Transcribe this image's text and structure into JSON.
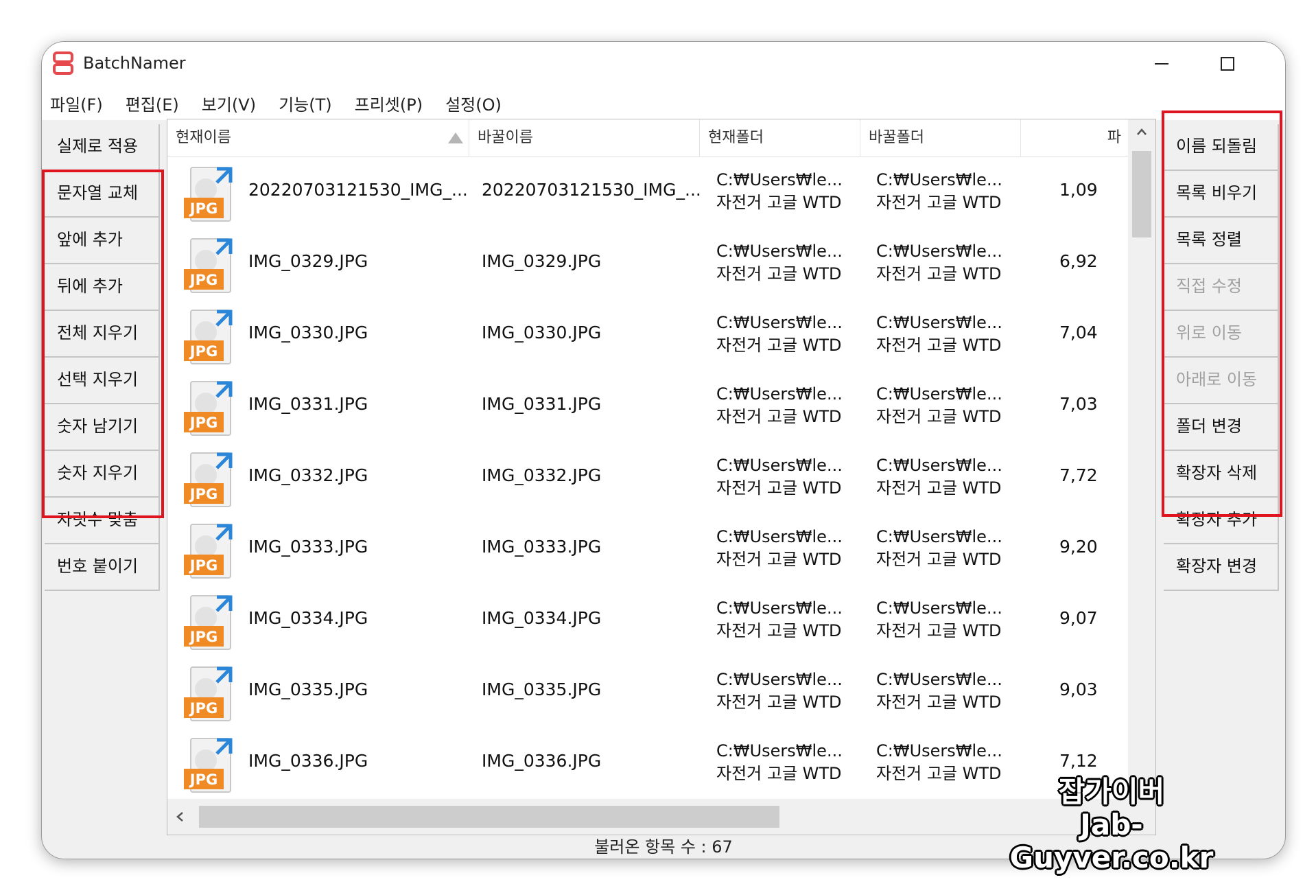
{
  "window": {
    "title": "BatchNamer"
  },
  "menu": [
    "파일(F)",
    "편집(E)",
    "보기(V)",
    "기능(T)",
    "프리셋(P)",
    "설정(O)"
  ],
  "left_buttons": [
    "실제로 적용",
    "문자열 교체",
    "앞에 추가",
    "뒤에 추가",
    "전체 지우기",
    "선택 지우기",
    "숫자 남기기",
    "숫자 지우기",
    "자릿수 맞춤",
    "번호 붙이기"
  ],
  "right_buttons": [
    {
      "label": "이름 되돌림",
      "enabled": true
    },
    {
      "label": "목록 비우기",
      "enabled": true
    },
    {
      "label": "목록 정렬",
      "enabled": true
    },
    {
      "label": "직접 수정",
      "enabled": false
    },
    {
      "label": "위로 이동",
      "enabled": false
    },
    {
      "label": "아래로 이동",
      "enabled": false
    },
    {
      "label": "폴더 변경",
      "enabled": true
    },
    {
      "label": "확장자 삭제",
      "enabled": true
    },
    {
      "label": "확장자 추가",
      "enabled": true
    },
    {
      "label": "확장자 변경",
      "enabled": true
    }
  ],
  "columns": [
    "현재이름",
    "바꿀이름",
    "현재폴더",
    "바꿀폴더",
    "파"
  ],
  "sort_indicator": "ascending",
  "thumb_label": "JPG",
  "rows": [
    {
      "name": "20220703121530_IMG_...",
      "newname": "20220703121530_IMG_...",
      "cur1": "C:₩Users₩le...",
      "cur2": "자전거 고글 WTD",
      "dst1": "C:₩Users₩le...",
      "dst2": "자전거 고글 WTD",
      "size": "1,09"
    },
    {
      "name": "IMG_0329.JPG",
      "newname": "IMG_0329.JPG",
      "cur1": "C:₩Users₩le...",
      "cur2": "자전거 고글 WTD",
      "dst1": "C:₩Users₩le...",
      "dst2": "자전거 고글 WTD",
      "size": "6,92"
    },
    {
      "name": "IMG_0330.JPG",
      "newname": "IMG_0330.JPG",
      "cur1": "C:₩Users₩le...",
      "cur2": "자전거 고글 WTD",
      "dst1": "C:₩Users₩le...",
      "dst2": "자전거 고글 WTD",
      "size": "7,04"
    },
    {
      "name": "IMG_0331.JPG",
      "newname": "IMG_0331.JPG",
      "cur1": "C:₩Users₩le...",
      "cur2": "자전거 고글 WTD",
      "dst1": "C:₩Users₩le...",
      "dst2": "자전거 고글 WTD",
      "size": "7,03"
    },
    {
      "name": "IMG_0332.JPG",
      "newname": "IMG_0332.JPG",
      "cur1": "C:₩Users₩le...",
      "cur2": "자전거 고글 WTD",
      "dst1": "C:₩Users₩le...",
      "dst2": "자전거 고글 WTD",
      "size": "7,72"
    },
    {
      "name": "IMG_0333.JPG",
      "newname": "IMG_0333.JPG",
      "cur1": "C:₩Users₩le...",
      "cur2": "자전거 고글 WTD",
      "dst1": "C:₩Users₩le...",
      "dst2": "자전거 고글 WTD",
      "size": "9,20"
    },
    {
      "name": "IMG_0334.JPG",
      "newname": "IMG_0334.JPG",
      "cur1": "C:₩Users₩le...",
      "cur2": "자전거 고글 WTD",
      "dst1": "C:₩Users₩le...",
      "dst2": "자전거 고글 WTD",
      "size": "9,07"
    },
    {
      "name": "IMG_0335.JPG",
      "newname": "IMG_0335.JPG",
      "cur1": "C:₩Users₩le...",
      "cur2": "자전거 고글 WTD",
      "dst1": "C:₩Users₩le...",
      "dst2": "자전거 고글 WTD",
      "size": "9,03"
    },
    {
      "name": "IMG_0336.JPG",
      "newname": "IMG_0336.JPG",
      "cur1": "C:₩Users₩le...",
      "cur2": "자전거 고글 WTD",
      "dst1": "C:₩Users₩le...",
      "dst2": "자전거 고글 WTD",
      "size": "7,12"
    }
  ],
  "status": "불러온 항목 수 : 67",
  "watermark": {
    "line1": "잡가이버",
    "line2": "Jab-Guyver.co.kr"
  },
  "colors": {
    "highlight": "#e0141e",
    "jpg_badge": "#f08a24",
    "app_icon": "#e5484d",
    "thumb_arrow": "#2a86d8"
  }
}
